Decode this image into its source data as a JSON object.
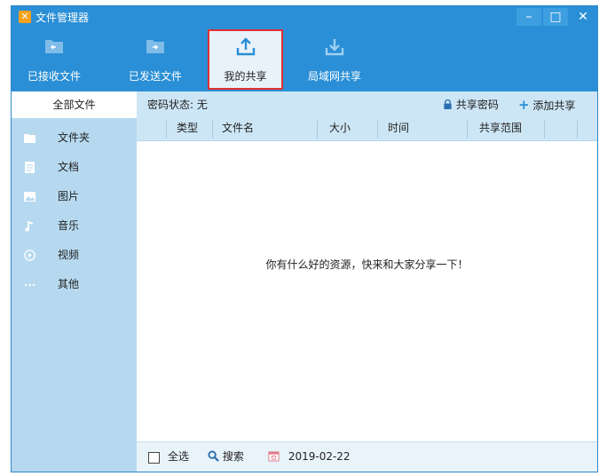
{
  "window": {
    "title": "文件管理器",
    "minimize_glyph": "–",
    "maximize_glyph": "□",
    "close_glyph": "✕"
  },
  "toolbar": {
    "items": [
      {
        "label": "已接收文件",
        "icon": "received-folder-icon"
      },
      {
        "label": "已发送文件",
        "icon": "sent-folder-icon"
      },
      {
        "label": "我的共享",
        "icon": "upload-icon",
        "active": true
      },
      {
        "label": "局域网共享",
        "icon": "download-icon"
      }
    ]
  },
  "sidebar": {
    "header": "全部文件",
    "items": [
      {
        "label": "文件夹",
        "icon": "folder-icon"
      },
      {
        "label": "文档",
        "icon": "document-icon"
      },
      {
        "label": "图片",
        "icon": "image-icon"
      },
      {
        "label": "音乐",
        "icon": "music-icon"
      },
      {
        "label": "视频",
        "icon": "video-icon"
      },
      {
        "label": "其他",
        "icon": "more-icon"
      }
    ]
  },
  "main": {
    "password_status": "密码状态: 无",
    "share_password": "共享密码",
    "add_share": "添加共享",
    "columns": [
      "类型",
      "文件名",
      "大小",
      "时间",
      "共享范围"
    ],
    "empty_message": "你有什么好的资源，快来和大家分享一下！"
  },
  "footer": {
    "select_all": "全选",
    "search": "搜索",
    "date": "2019-02-22"
  },
  "colors": {
    "header_blue": "#2a8fd6",
    "sidebar_blue": "#b6d9ef",
    "highlight_red": "#e03131"
  }
}
